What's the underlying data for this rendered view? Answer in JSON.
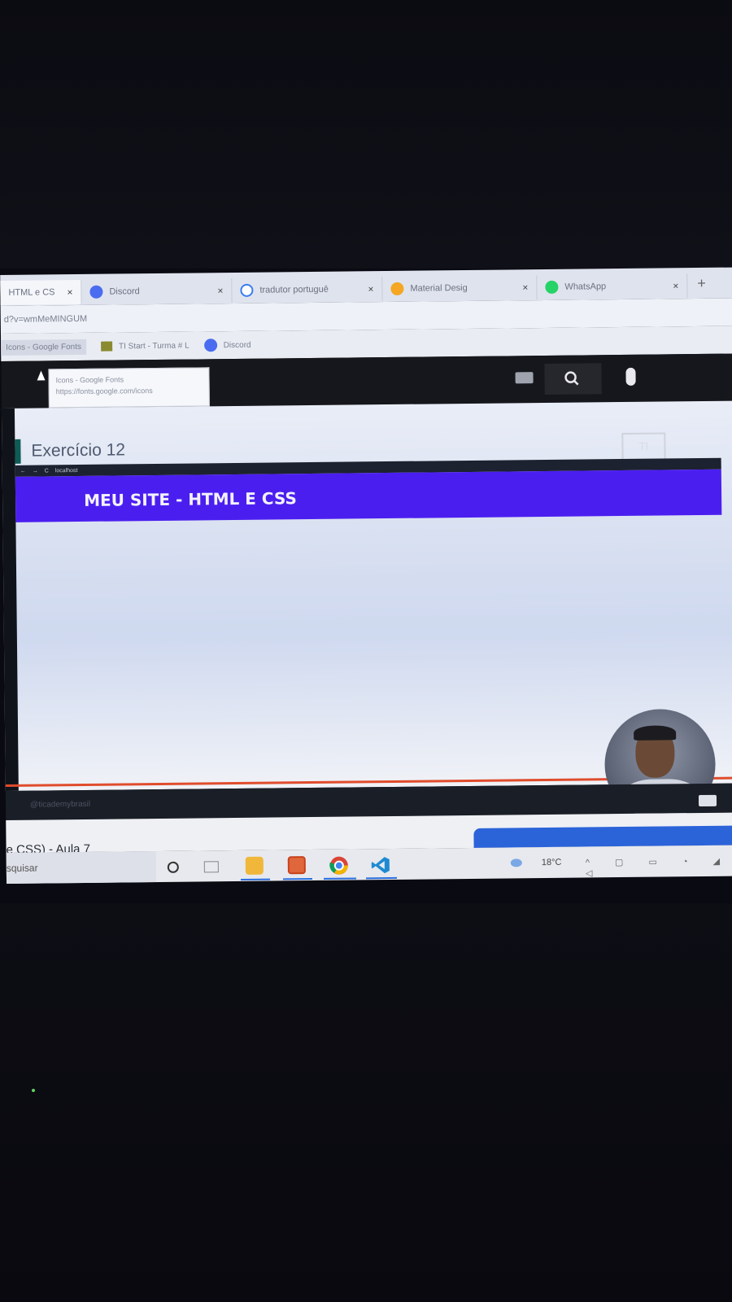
{
  "browser": {
    "tabs": [
      {
        "label": "HTML e CS",
        "icon": "youtube-icon",
        "color": "#d33"
      },
      {
        "label": "Discord",
        "icon": "discord-icon",
        "color": "#4a6cf0"
      },
      {
        "label": "tradutor portuguê",
        "icon": "google-icon",
        "color": "#3b7ded"
      },
      {
        "label": "Material Desig",
        "icon": "material-icon",
        "color": "#f5a623"
      },
      {
        "label": "WhatsApp",
        "icon": "whatsapp-icon",
        "color": "#25d366"
      }
    ],
    "close_glyph": "×",
    "new_tab_glyph": "+",
    "url": "d?v=wmMeMINGUM",
    "bookmarks": [
      {
        "label": "Icons - Google Fonts"
      },
      {
        "label": "TI Start - Turma # L"
      },
      {
        "label": "Discord"
      }
    ],
    "tooltip": {
      "title": "Icons - Google Fonts",
      "url": "https://fonts.google.com/icons"
    }
  },
  "video": {
    "exercise_title": "Exercício 12",
    "mini_browser_url": "localhost",
    "banner_text": "MEU SITE - HTML E CSS",
    "watermark_top": "TI",
    "watermark_bottom": "academy",
    "channel_handle": "@ticademybrasil"
  },
  "page": {
    "video_title": "e CSS) - Aula 7"
  },
  "taskbar": {
    "search_placeholder": "squisar",
    "weather": "18°C",
    "tray_glyphs": "^ ▢ ▭ ◔ ◢ ◁"
  }
}
